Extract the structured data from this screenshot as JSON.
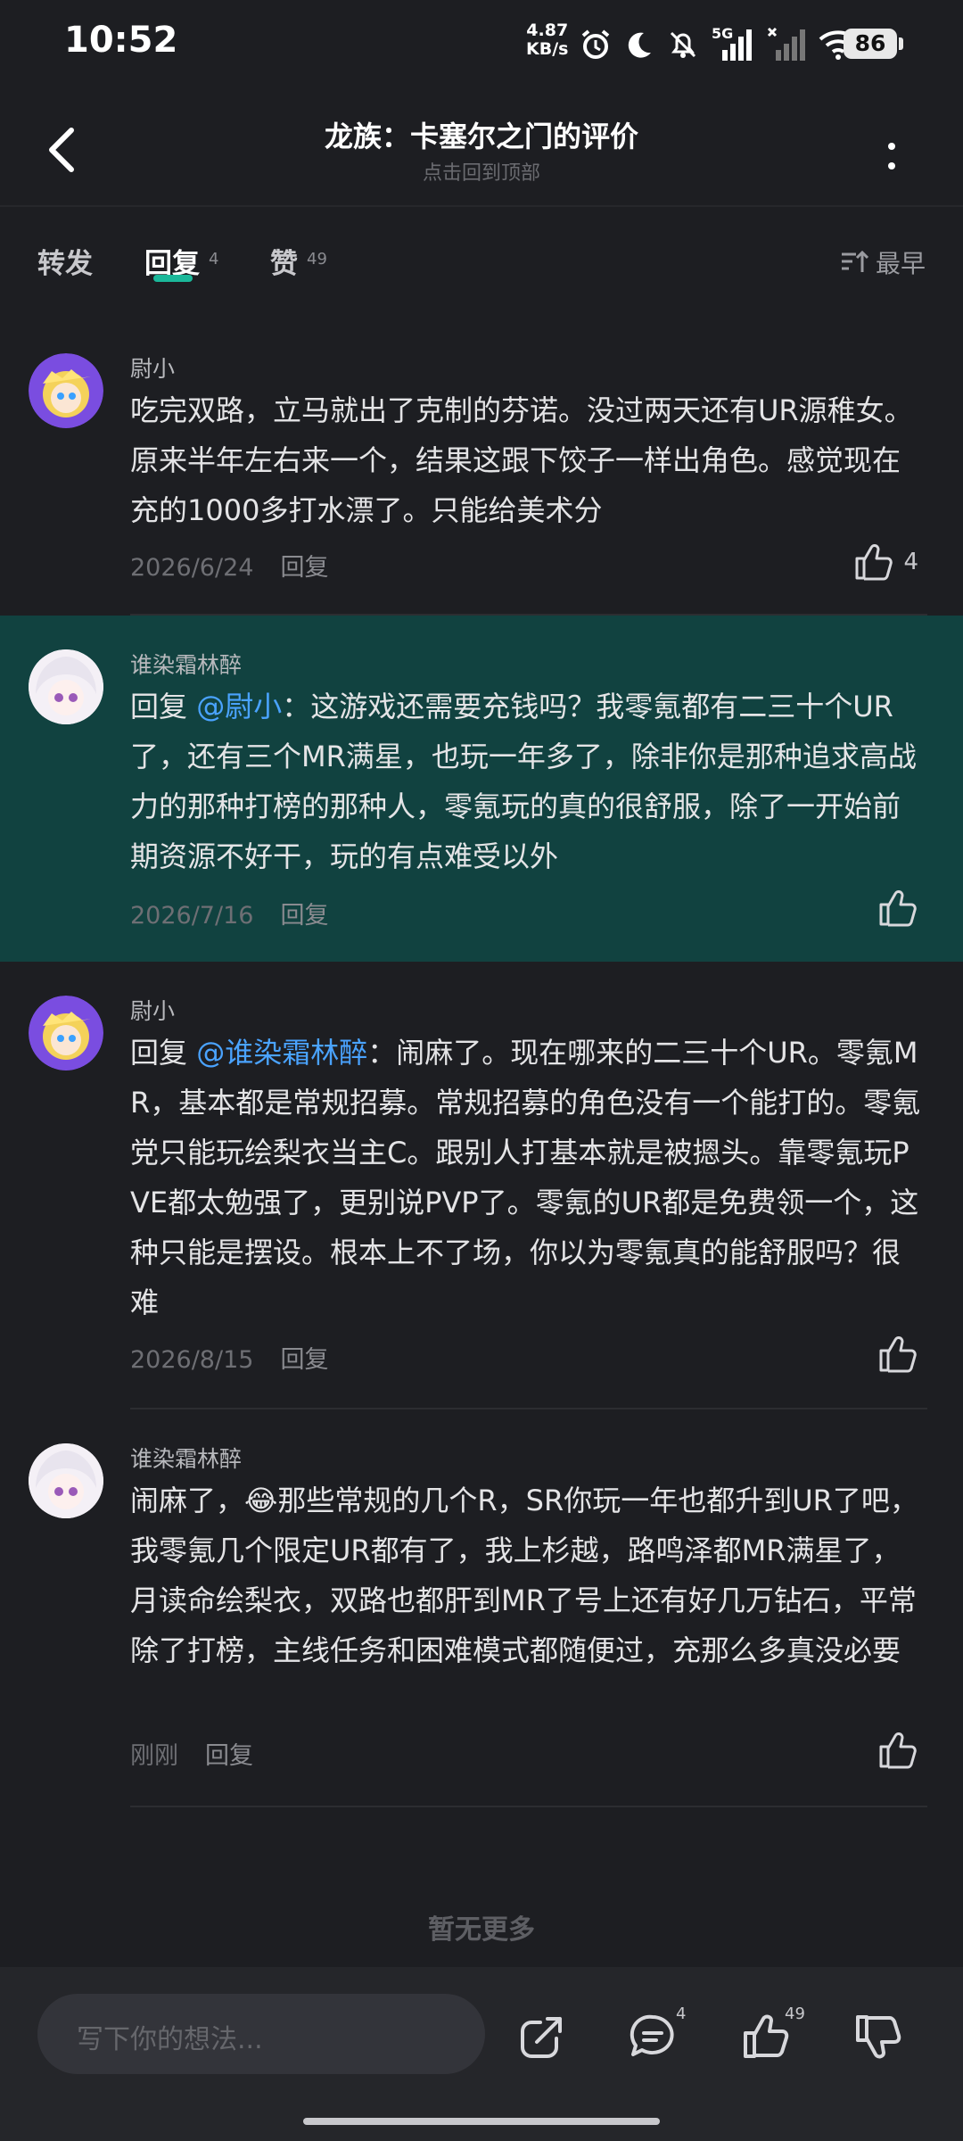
{
  "status": {
    "time": "10:52",
    "speed_value": "4.87",
    "speed_unit": "KB/s",
    "network": "5G",
    "battery": "86"
  },
  "header": {
    "title": "龙族：卡塞尔之门的评价",
    "subtitle": "点击回到顶部"
  },
  "tabs": {
    "forward": "转发",
    "reply": "回复",
    "reply_count": "4",
    "like": "赞",
    "like_count": "49",
    "sort": "最早"
  },
  "comments": [
    {
      "user": "尉小",
      "text": "吃完双路，立马就出了克制的芬诺。没过两天还有UR源稚女。原来半年左右来一个，结果这跟下饺子一样出角色。感觉现在充的1000多打水漂了。只能给美术分",
      "date": "2026/6/24",
      "reply_label": "回复",
      "likes": "4"
    },
    {
      "user": "谁染霜林醉",
      "reply_prefix": "回复 ",
      "mention": "@尉小",
      "text": "：这游戏还需要充钱吗？我零氪都有二三十个UR了，还有三个MR满星，也玩一年多了，除非你是那种追求高战力的那种打榜的那种人，零氪玩的真的很舒服，除了一开始前期资源不好干，玩的有点难受以外",
      "date": "2026/7/16",
      "reply_label": "回复"
    },
    {
      "user": "尉小",
      "reply_prefix": "回复 ",
      "mention": "@谁染霜林醉",
      "text": "：闹麻了。现在哪来的二三十个UR。零氪MR，基本都是常规招募。常规招募的角色没有一个能打的。零氪党只能玩绘梨衣当主C。跟别人打基本就是被摁头。靠零氪玩PVE都太勉强了，更别说PVP了。零氪的UR都是免费领一个，这种只能是摆设。根本上不了场，你以为零氪真的能舒服吗？很难",
      "date": "2026/8/15",
      "reply_label": "回复"
    },
    {
      "user": "谁染霜林醉",
      "text_before_emoji": "闹麻了，",
      "emoji": "😂",
      "text": "那些常规的几个R，SR你玩一年也都升到UR了吧，我零氪几个限定UR都有了，我上杉越，路鸣泽都MR满星了，月读命绘梨衣，双路也都肝到MR了号上还有好几万钻石，平常除了打榜，主线任务和困难模式都随便过，充那么多真没必要",
      "date": "刚刚",
      "reply_label": "回复"
    }
  ],
  "no_more": "暂无更多",
  "bottom": {
    "placeholder": "写下你的想法...",
    "comment_count": "4",
    "like_count": "49"
  },
  "colors": {
    "background": "#1d1e22",
    "highlight": "#114240",
    "accent": "#1bb89a",
    "mention": "#4aa3ff"
  },
  "icons": [
    "back-arrow-icon",
    "more-vertical-icon",
    "sort-icon",
    "thumb-up-icon",
    "share-icon",
    "comment-icon",
    "thumb-down-icon",
    "alarm-icon",
    "moon-icon",
    "bell-off-icon",
    "signal-icon",
    "wifi-icon"
  ]
}
